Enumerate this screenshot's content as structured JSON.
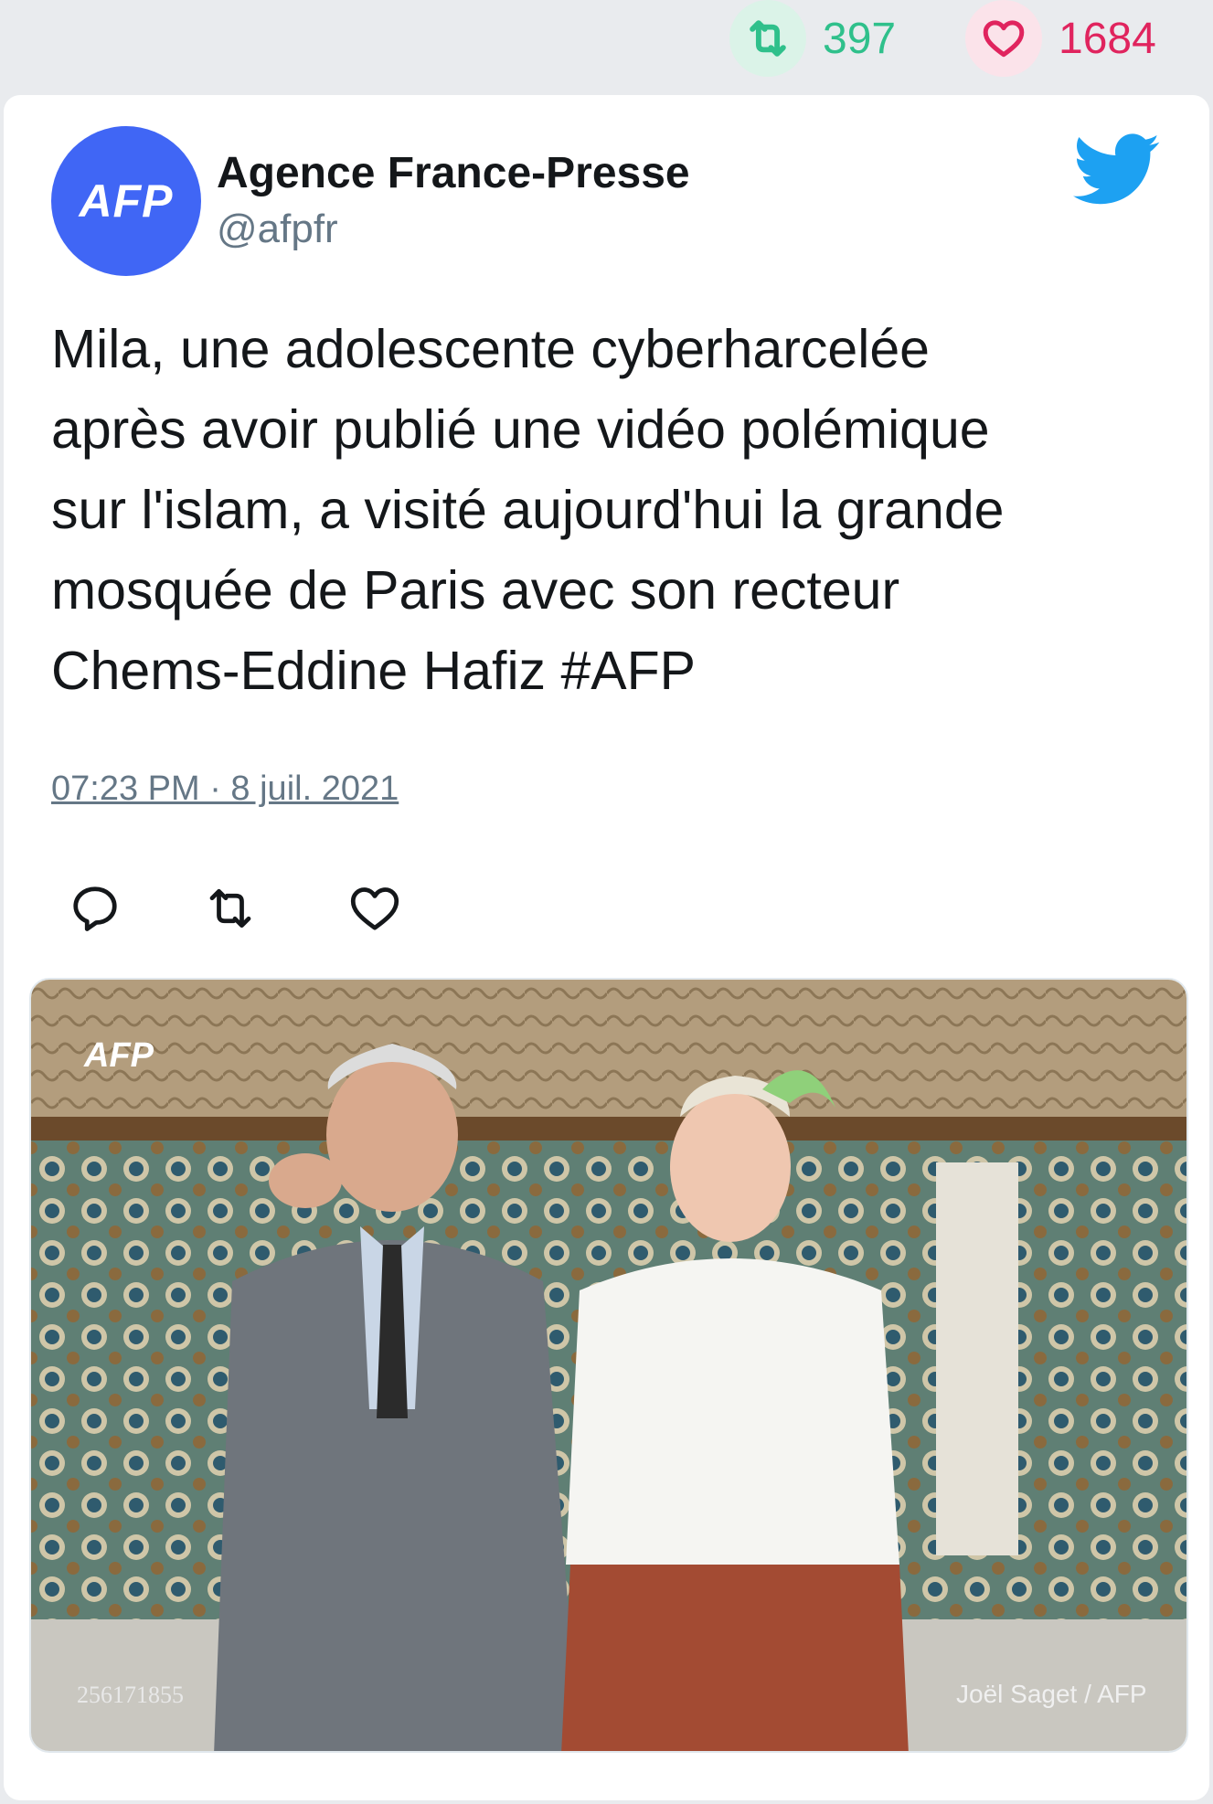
{
  "stats": {
    "retweets": "397",
    "likes": "1684",
    "retweet_color": "#2fc08b",
    "like_color": "#e0245e"
  },
  "author": {
    "avatar_text": "AFP",
    "name": "Agence France-Presse",
    "handle": "@afpfr",
    "avatar_color": "#4066f5"
  },
  "tweet": {
    "lines": [
      "Mila, une adolescente cyberharcelée",
      "après avoir publié une vidéo polémique",
      "sur l'islam, a visité aujourd'hui la grande",
      "mosquée de Paris avec son recteur",
      "Chems-Eddine Hafiz #AFP"
    ],
    "timestamp": "07:23 PM · 8 juil. 2021"
  },
  "icons": {
    "brand": "twitter-bird-icon",
    "reply": "reply-icon",
    "retweet": "retweet-icon",
    "like": "heart-icon"
  },
  "photo": {
    "watermark": "AFP",
    "image_id": "256171855",
    "credit": "Joël Saget / AFP"
  },
  "brand_color": "#1da1f2"
}
